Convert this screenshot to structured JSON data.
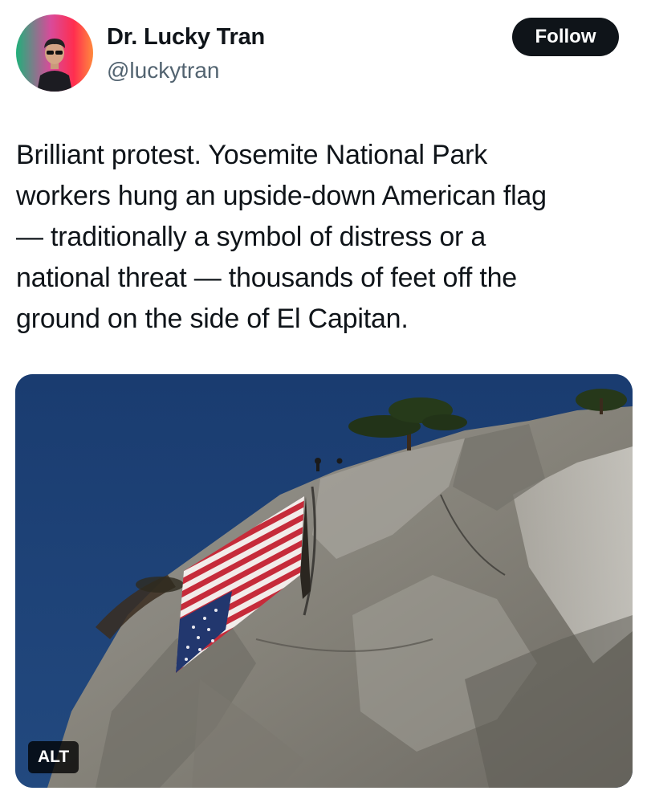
{
  "author": {
    "display_name": "Dr. Lucky Tran",
    "handle": "@luckytran",
    "follow_label": "Follow",
    "avatar_icon": "profile-photo-icon"
  },
  "tweet": {
    "lines": [
      "Brilliant protest. Yosemite National Park",
      "workers hung an upside-down American flag",
      "— traditionally a symbol of distress or a",
      "national threat — thousands of feet off the",
      "ground on the side of El Capitan."
    ]
  },
  "media": {
    "alt_label": "ALT",
    "sky_color": "#1c3f74",
    "rock_color": "#8b8983"
  },
  "colors": {
    "text_primary": "#0f1419",
    "text_secondary": "#536471",
    "follow_bg": "#0f1419"
  }
}
